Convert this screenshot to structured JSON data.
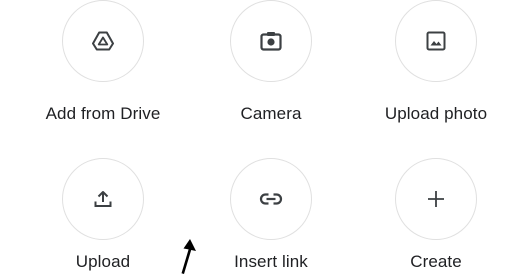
{
  "options": [
    {
      "label": "Add from Drive",
      "icon": "drive-icon"
    },
    {
      "label": "Camera",
      "icon": "camera-icon"
    },
    {
      "label": "Upload photo",
      "icon": "image-icon"
    },
    {
      "label": "Upload",
      "icon": "upload-icon"
    },
    {
      "label": "Insert link",
      "icon": "link-icon"
    },
    {
      "label": "Create",
      "icon": "plus-icon"
    }
  ],
  "colors": {
    "icon": "#3c4043",
    "circle_border": "#e0e0e0",
    "text": "#202124"
  }
}
